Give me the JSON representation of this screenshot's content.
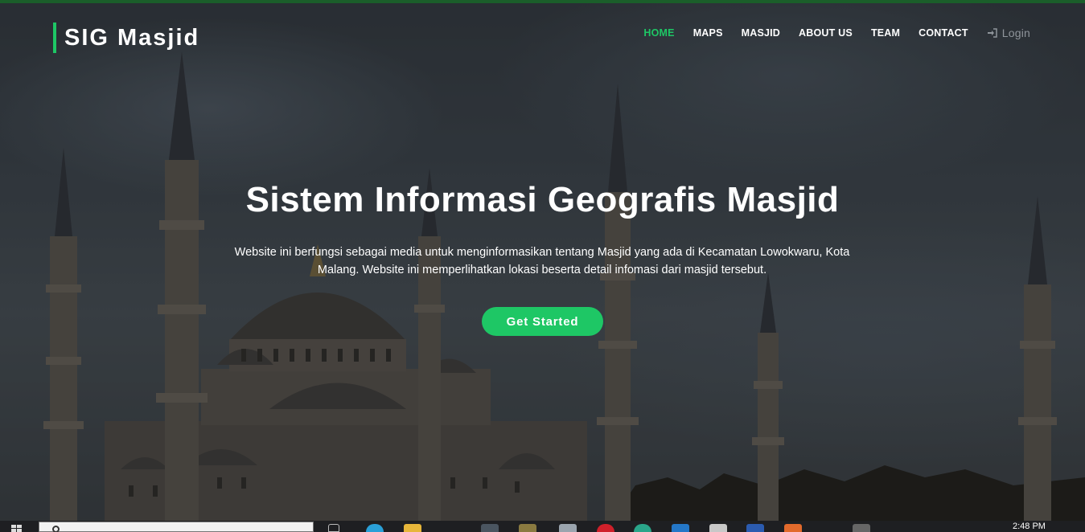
{
  "brand": {
    "name": "SIG Masjid",
    "accent_color": "#1ec765"
  },
  "nav": {
    "items": [
      {
        "label": "HOME",
        "active": true
      },
      {
        "label": "MAPS",
        "active": false
      },
      {
        "label": "MASJID",
        "active": false
      },
      {
        "label": "ABOUT US",
        "active": false
      },
      {
        "label": "TEAM",
        "active": false
      },
      {
        "label": "CONTACT",
        "active": false
      }
    ],
    "login": {
      "label": "Login",
      "icon": "sign-in-icon"
    }
  },
  "hero": {
    "title": "Sistem Informasi Geografis Masjid",
    "description": "Website ini berfungsi sebagai media untuk menginformasikan tentang Masjid yang ada di Kecamatan Lowokwaru, Kota Malang. Website ini memperlihatkan lokasi beserta detail infomasi dari masjid tersebut.",
    "cta_label": "Get Started",
    "background": "mosque-photo"
  },
  "taskbar": {
    "start_icon": "windows-start-icon",
    "search_icon": "search-icon",
    "time": "2:48 PM"
  }
}
